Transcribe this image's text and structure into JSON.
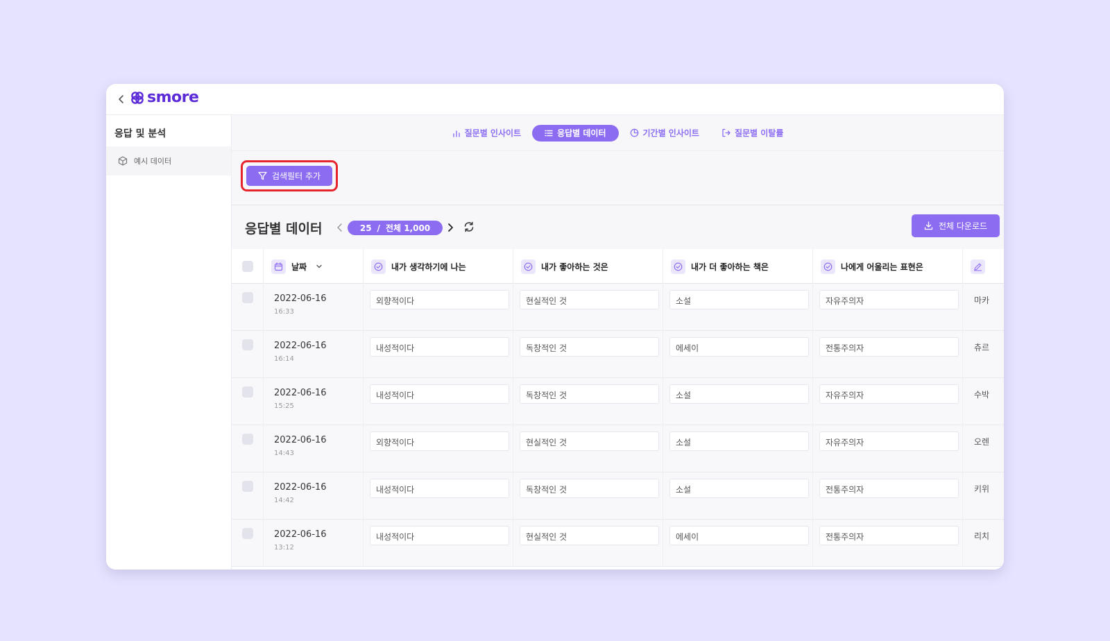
{
  "app": {
    "logo_text": "smore",
    "brand_color": "#5b2bd8",
    "accent_color": "#8c6cf0",
    "highlight_color": "#e6242d",
    "back_icon": "chevron-left-icon"
  },
  "sidebar": {
    "title": "응답 및 분석",
    "items": [
      {
        "label": "예시 데이터",
        "icon": "cube-icon"
      }
    ]
  },
  "tabs": [
    {
      "label": "질문별 인사이트",
      "icon": "bar-chart-icon",
      "active": false
    },
    {
      "label": "응답별 데이터",
      "icon": "list-icon",
      "active": true
    },
    {
      "label": "기간별 인사이트",
      "icon": "pie-chart-icon",
      "active": false
    },
    {
      "label": "질문별 이탈률",
      "icon": "exit-icon",
      "active": false
    }
  ],
  "filter": {
    "label": "검색필터 추가",
    "icon": "filter-icon"
  },
  "section": {
    "title": "응답별 데이터",
    "page_size": "25",
    "separator": "/",
    "total": "전체 1,000",
    "download_label": "전체 다운로드"
  },
  "table": {
    "columns": [
      {
        "label": "날짜",
        "icon": "calendar-icon"
      },
      {
        "label": "내가 생각하기에 나는",
        "icon": "check-circle-icon"
      },
      {
        "label": "내가 좋아하는 것은",
        "icon": "check-circle-icon"
      },
      {
        "label": "내가 더 좋아하는 책은",
        "icon": "check-circle-icon"
      },
      {
        "label": "나에게 어울리는 표현은",
        "icon": "check-circle-icon"
      },
      {
        "label": "",
        "icon": "pencil-icon"
      }
    ],
    "rows": [
      {
        "date": "2022-06-16",
        "time": "16:33",
        "a1": "외향적이다",
        "a2": "현실적인 것",
        "a3": "소설",
        "a4": "자유주의자",
        "a5": "마카"
      },
      {
        "date": "2022-06-16",
        "time": "16:14",
        "a1": "내성적이다",
        "a2": "독창적인 것",
        "a3": "에세이",
        "a4": "전통주의자",
        "a5": "츄르"
      },
      {
        "date": "2022-06-16",
        "time": "15:25",
        "a1": "내성적이다",
        "a2": "독창적인 것",
        "a3": "소설",
        "a4": "자유주의자",
        "a5": "수박"
      },
      {
        "date": "2022-06-16",
        "time": "14:43",
        "a1": "외향적이다",
        "a2": "현실적인 것",
        "a3": "소설",
        "a4": "자유주의자",
        "a5": "오렌"
      },
      {
        "date": "2022-06-16",
        "time": "14:42",
        "a1": "내성적이다",
        "a2": "독창적인 것",
        "a3": "소설",
        "a4": "전통주의자",
        "a5": "키위"
      },
      {
        "date": "2022-06-16",
        "time": "13:12",
        "a1": "내성적이다",
        "a2": "현실적인 것",
        "a3": "에세이",
        "a4": "전통주의자",
        "a5": "리치"
      }
    ]
  }
}
